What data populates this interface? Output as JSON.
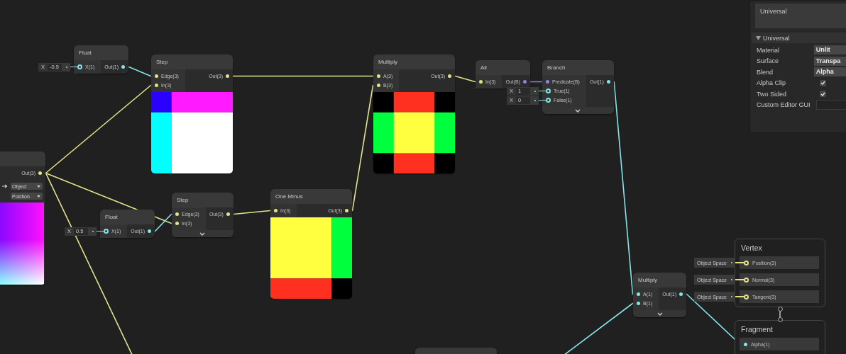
{
  "nodes": [
    {
      "outputs": [
        {
          "label": "Out(3)",
          "color": "#e2e28a"
        }
      ],
      "control_rows": [
        [
          {
            "kind": "arrow"
          },
          {
            "kind": "dropdown",
            "value": "Object"
          }
        ],
        [
          {
            "kind": "dropdown",
            "value": "Position"
          }
        ]
      ],
      "preview": true
    },
    {
      "title": "Float",
      "inputs": [
        {
          "label": "X(1)",
          "color": "#84e4e7",
          "inline": {
            "label": "X",
            "value": "-0.5"
          }
        }
      ],
      "outputs": [
        {
          "label": "Out(1)",
          "color": "#84e4e7"
        }
      ]
    },
    {
      "title": "Step",
      "inputs": [
        {
          "label": "Edge(3)",
          "color": "#e2e28a"
        },
        {
          "label": "In(3)",
          "color": "#e2e28a"
        }
      ],
      "outputs": [
        {
          "label": "Out(3)",
          "color": "#e2e28a"
        }
      ],
      "preview": true
    },
    {
      "title": "Multiply",
      "inputs": [
        {
          "label": "A(3)",
          "color": "#e2e28a"
        },
        {
          "label": "B(3)",
          "color": "#e2e28a"
        }
      ],
      "outputs": [
        {
          "label": "Out(3)",
          "color": "#e2e28a"
        }
      ],
      "preview": true
    },
    {
      "title": "All",
      "inputs": [
        {
          "label": "In(3)",
          "color": "#e2e28a"
        }
      ],
      "outputs": [
        {
          "label": "Out(B)",
          "color": "#9481e6"
        }
      ]
    },
    {
      "title": "Branch",
      "inputs": [
        {
          "label": "Predicate(B)",
          "color": "#9481e6"
        },
        {
          "label": "True(1)",
          "color": "#84e4e7",
          "inline": {
            "label": "X",
            "value": "1"
          }
        },
        {
          "label": "False(1)",
          "color": "#84e4e7",
          "inline": {
            "label": "X",
            "value": "0"
          }
        }
      ],
      "outputs": [
        {
          "label": "Out(1)",
          "color": "#84e4e7"
        }
      ],
      "collapsible": true
    },
    {
      "title": "Float",
      "inputs": [
        {
          "label": "X(1)",
          "color": "#84e4e7",
          "inline": {
            "label": "X",
            "value": "0.5"
          }
        }
      ],
      "outputs": [
        {
          "label": "Out(1)",
          "color": "#84e4e7"
        }
      ]
    },
    {
      "title": "Step",
      "inputs": [
        {
          "label": "Edge(3)",
          "color": "#e2e28a"
        },
        {
          "label": "In(3)",
          "color": "#e2e28a"
        }
      ],
      "outputs": [
        {
          "label": "Out(3)",
          "color": "#e2e28a"
        }
      ],
      "collapsible": true
    },
    {
      "title": "One Minus",
      "inputs": [
        {
          "label": "In(3)",
          "color": "#e2e28a"
        }
      ],
      "outputs": [
        {
          "label": "Out(3)",
          "color": "#e2e28a"
        }
      ],
      "preview": true
    },
    {
      "title": "Multiply",
      "inputs": [
        {
          "label": "A(1)",
          "color": "#84e4e7"
        },
        {
          "label": "B(1)",
          "color": "#84e4e7"
        }
      ],
      "outputs": [
        {
          "label": "Out(1)",
          "color": "#84e4e7"
        }
      ],
      "collapsible": true
    },
    {
      "stub": true
    }
  ],
  "stack": [
    {
      "title": "Vertex",
      "blocks": [
        {
          "label": "Position(3)",
          "color": "#e2e28a",
          "inline": {
            "value": "Object Space"
          }
        },
        {
          "label": "Normal(3)",
          "color": "#e2e28a",
          "inline": {
            "value": "Object Space"
          }
        },
        {
          "label": "Tangent(3)",
          "color": "#e2e28a",
          "inline": {
            "value": "Object Space"
          }
        }
      ]
    },
    {
      "title": "Fragment",
      "blocks": [
        {
          "label": "Alpha(1)",
          "color": "#84e4e7"
        }
      ]
    }
  ],
  "inspector": {
    "target_field": {
      "value": "Universal"
    },
    "section": {
      "title": "Universal",
      "expanded": true
    },
    "rows": [
      {
        "label": "Material",
        "kind": "dropdown",
        "value": "Unlit"
      },
      {
        "label": "Surface",
        "kind": "dropdown",
        "value": "Transpa"
      },
      {
        "label": "Blend",
        "kind": "dropdown",
        "value": "Alpha"
      },
      {
        "label": "Alpha Clip",
        "kind": "checkbox",
        "checked": true
      },
      {
        "label": "Two Sided",
        "kind": "checkbox",
        "checked": true
      },
      {
        "label": "Custom Editor GUI",
        "kind": "field"
      }
    ]
  }
}
